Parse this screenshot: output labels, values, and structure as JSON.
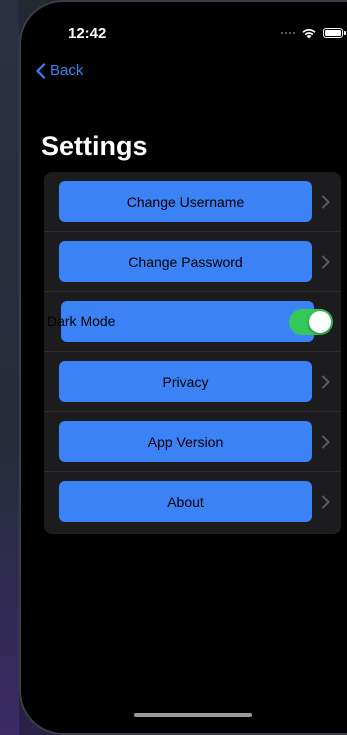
{
  "status_bar": {
    "time": "12:42"
  },
  "nav": {
    "back_label": "Back"
  },
  "page": {
    "title": "Settings"
  },
  "settings": {
    "items": [
      {
        "label": "Change Username",
        "type": "button"
      },
      {
        "label": "Change Password",
        "type": "button"
      },
      {
        "label": "Dark Mode",
        "type": "toggle",
        "value": true
      },
      {
        "label": "Privacy",
        "type": "button"
      },
      {
        "label": "App Version",
        "type": "button"
      },
      {
        "label": "About",
        "type": "button"
      }
    ]
  },
  "colors": {
    "accent": "#3b82f6",
    "toggle_on": "#34c759",
    "background": "#000000",
    "card": "#1c1c1e"
  },
  "icons": {
    "back": "chevron-left-icon",
    "row_disclosure": "chevron-right-icon",
    "wifi": "wifi-icon",
    "battery": "battery-icon",
    "signal": "cellular-signal-icon"
  }
}
